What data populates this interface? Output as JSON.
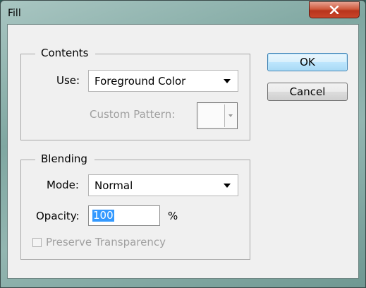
{
  "window": {
    "title": "Fill"
  },
  "contents": {
    "group_title": "Contents",
    "use_label": "Use:",
    "use_value": "Foreground Color",
    "custom_pattern_label": "Custom Pattern:"
  },
  "blending": {
    "group_title": "Blending",
    "mode_label": "Mode:",
    "mode_value": "Normal",
    "opacity_label": "Opacity:",
    "opacity_value": "100",
    "opacity_unit": "%",
    "preserve_label": "Preserve Transparency",
    "preserve_checked": false
  },
  "buttons": {
    "ok": "OK",
    "cancel": "Cancel"
  },
  "icons": {
    "close": "close-icon",
    "dropdown": "chevron-down-icon"
  },
  "colors": {
    "selection": "#3399ff",
    "close_button": "#c8452a",
    "default_button_border": "#3c7fb1"
  }
}
